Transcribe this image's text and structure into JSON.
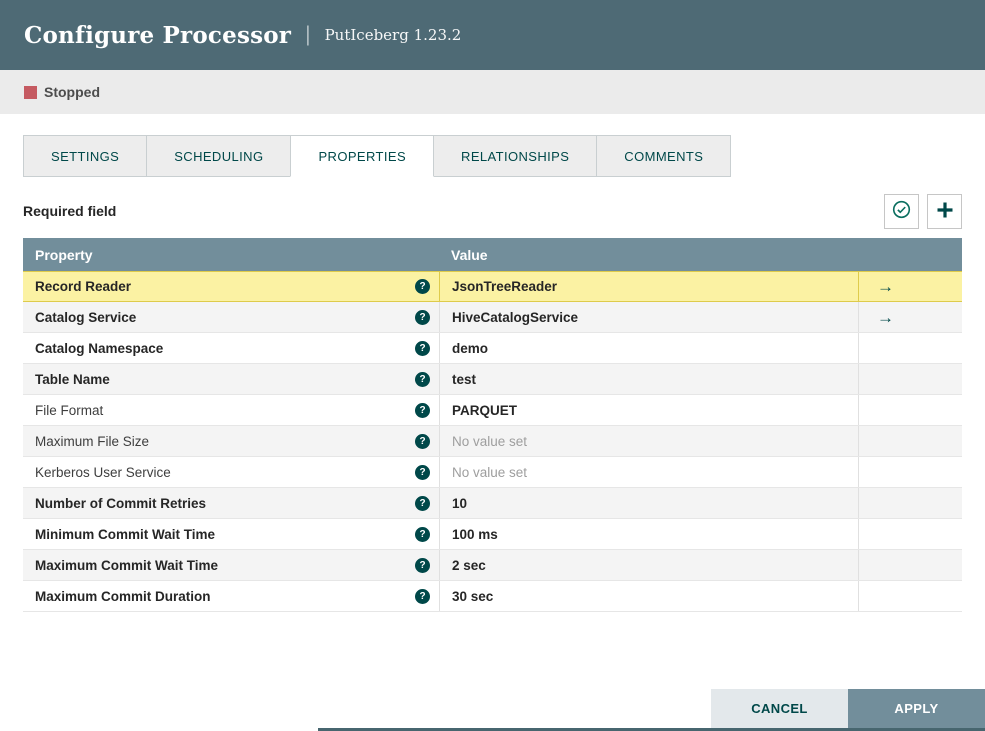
{
  "header": {
    "title": "Configure Processor",
    "separator": "|",
    "subtitle": "PutIceberg 1.23.2"
  },
  "status": {
    "label": "Stopped"
  },
  "tabs": [
    {
      "label": "SETTINGS",
      "active": false
    },
    {
      "label": "SCHEDULING",
      "active": false
    },
    {
      "label": "PROPERTIES",
      "active": true
    },
    {
      "label": "RELATIONSHIPS",
      "active": false
    },
    {
      "label": "COMMENTS",
      "active": false
    }
  ],
  "toolbar": {
    "required_label": "Required field",
    "verify_button_icon": "check-circle-icon",
    "add_button_icon": "plus-icon"
  },
  "icons": {
    "help_glyph": "?",
    "goto_glyph": "→",
    "stopped_icon": "stop-square-icon"
  },
  "table": {
    "columns": [
      "Property",
      "Value"
    ],
    "rows": [
      {
        "property": "Record Reader",
        "required": true,
        "value": "JsonTreeReader",
        "unset": false,
        "has_link": true,
        "highlighted": true
      },
      {
        "property": "Catalog Service",
        "required": true,
        "value": "HiveCatalogService",
        "unset": false,
        "has_link": true,
        "highlighted": false
      },
      {
        "property": "Catalog Namespace",
        "required": true,
        "value": "demo",
        "unset": false,
        "has_link": false,
        "highlighted": false
      },
      {
        "property": "Table Name",
        "required": true,
        "value": "test",
        "unset": false,
        "has_link": false,
        "highlighted": false
      },
      {
        "property": "File Format",
        "required": false,
        "value": "PARQUET",
        "unset": false,
        "has_link": false,
        "highlighted": false
      },
      {
        "property": "Maximum File Size",
        "required": false,
        "value": "No value set",
        "unset": true,
        "has_link": false,
        "highlighted": false
      },
      {
        "property": "Kerberos User Service",
        "required": false,
        "value": "No value set",
        "unset": true,
        "has_link": false,
        "highlighted": false
      },
      {
        "property": "Number of Commit Retries",
        "required": true,
        "value": "10",
        "unset": false,
        "has_link": false,
        "highlighted": false
      },
      {
        "property": "Minimum Commit Wait Time",
        "required": true,
        "value": "100 ms",
        "unset": false,
        "has_link": false,
        "highlighted": false
      },
      {
        "property": "Maximum Commit Wait Time",
        "required": true,
        "value": "2 sec",
        "unset": false,
        "has_link": false,
        "highlighted": false
      },
      {
        "property": "Maximum Commit Duration",
        "required": true,
        "value": "30 sec",
        "unset": false,
        "has_link": false,
        "highlighted": false
      }
    ]
  },
  "footer": {
    "cancel_label": "CANCEL",
    "apply_label": "APPLY"
  },
  "colors": {
    "header_bg": "#4E6A75",
    "status_bar_bg": "#EBEBEB",
    "stopped_color": "#C55A61",
    "accent": "#004849",
    "table_header_bg": "#728E9B",
    "row_alt_bg": "#F4F4F4",
    "highlight_bg": "#FBF2A3",
    "highlight_border": "#DECB4B",
    "apply_bg": "#728E9B",
    "verify_icon_color": "#0A6E5F"
  }
}
